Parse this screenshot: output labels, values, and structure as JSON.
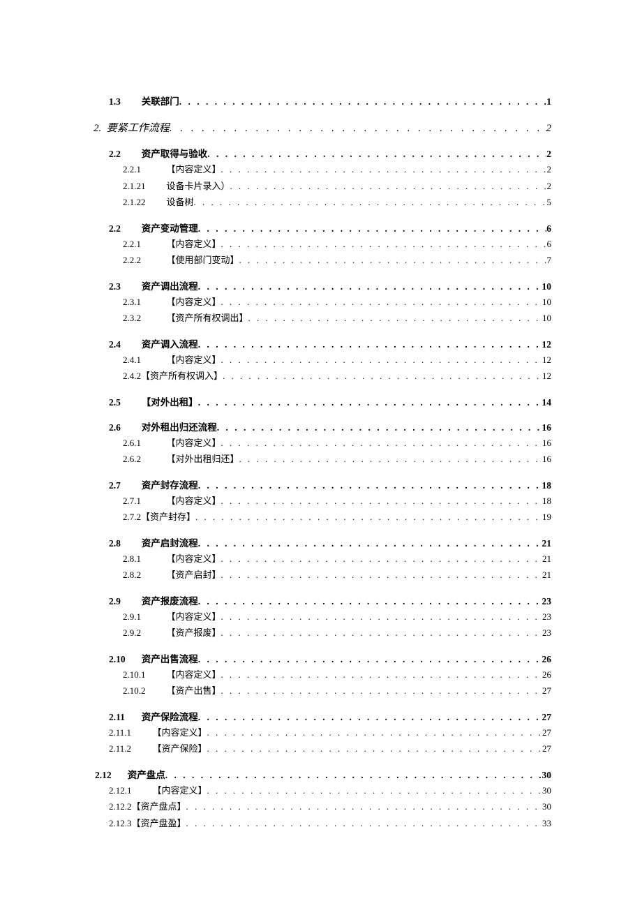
{
  "toc": [
    {
      "id": "r0",
      "level": "lvl2",
      "num": "1.3",
      "title": "关联部门",
      "page": "1"
    },
    {
      "id": "r1",
      "level": "lvl1",
      "num": "2.",
      "title": "要紧工作流程",
      "page": "2"
    },
    {
      "id": "r2",
      "level": "lvl2",
      "num": "2.2",
      "title": "资产取得与验收",
      "page": "2"
    },
    {
      "id": "r3",
      "level": "lvl3",
      "num": "2.2.1",
      "title": "【内容定义】",
      "page": "2"
    },
    {
      "id": "r4",
      "level": "lvl3",
      "num": "2.1.21",
      "title": "设备卡片录入）",
      "page": "2"
    },
    {
      "id": "r5",
      "level": "lvl3",
      "num": "2.1.22",
      "title": "设备树",
      "page": "5"
    },
    {
      "id": "r6",
      "level": "lvl2",
      "num": "2.2",
      "title": "资产变动管理",
      "page": "6"
    },
    {
      "id": "r7",
      "level": "lvl3",
      "num": "2.2.1",
      "title": "【内容定义】",
      "page": "6"
    },
    {
      "id": "r8",
      "level": "lvl3",
      "num": "2.2.2",
      "title": "【使用部门变动】",
      "page": "7"
    },
    {
      "id": "r9",
      "level": "lvl2",
      "num": "2.3",
      "title": "资产调出流程",
      "page": "10"
    },
    {
      "id": "r10",
      "level": "lvl3",
      "num": "2.3.1",
      "title": "【内容定义】",
      "page": "10"
    },
    {
      "id": "r11",
      "level": "lvl3",
      "num": "2.3.2",
      "title": "【资产所有权调出】",
      "page": "10"
    },
    {
      "id": "r12",
      "level": "lvl2",
      "num": "2.4",
      "title": "资产调入流程",
      "page": "12"
    },
    {
      "id": "r13",
      "level": "lvl3",
      "num": "2.4.1",
      "title": "【内容定义】",
      "page": "12"
    },
    {
      "id": "r14",
      "level": "lvl3 tight",
      "num": "2.4.2",
      "title": "【资产所有权调入】",
      "page": "12"
    },
    {
      "id": "r15",
      "level": "lvl2",
      "num": "2.5",
      "title": "【对外出租】",
      "page": "14"
    },
    {
      "id": "r16",
      "level": "lvl2",
      "num": "2.6",
      "title": "对外租出归还流程",
      "page": "16"
    },
    {
      "id": "r17",
      "level": "lvl3",
      "num": "2.6.1",
      "title": "【内容定义】",
      "page": "16"
    },
    {
      "id": "r18",
      "level": "lvl3",
      "num": "2.6.2",
      "title": "【对外出租归还】",
      "page": "16"
    },
    {
      "id": "r19",
      "level": "lvl2",
      "num": "2.7",
      "title": "资产封存流程",
      "page": "18"
    },
    {
      "id": "r20",
      "level": "lvl3",
      "num": "2.7.1",
      "title": "【内容定义】",
      "page": "18"
    },
    {
      "id": "r21",
      "level": "lvl3 tight",
      "num": "2.7.2",
      "title": "【资产封存】",
      "page": "19"
    },
    {
      "id": "r22",
      "level": "lvl2",
      "num": "2.8",
      "title": "资产启封流程",
      "page": "21"
    },
    {
      "id": "r23",
      "level": "lvl3",
      "num": "2.8.1",
      "title": "【内容定义】",
      "page": "21"
    },
    {
      "id": "r24",
      "level": "lvl3",
      "num": "2.8.2",
      "title": "【资产启封】",
      "page": "21"
    },
    {
      "id": "r25",
      "level": "lvl2",
      "num": "2.9",
      "title": "资产报废流程",
      "page": "23"
    },
    {
      "id": "r26",
      "level": "lvl3",
      "num": "2.9.1",
      "title": "【内容定义】",
      "page": "23"
    },
    {
      "id": "r27",
      "level": "lvl3",
      "num": "2.9.2",
      "title": "【资产报废】",
      "page": "23"
    },
    {
      "id": "r28",
      "level": "lvl2",
      "num": "2.10",
      "title": "资产出售流程",
      "page": "26"
    },
    {
      "id": "r29",
      "level": "lvl3",
      "num": "2.10.1",
      "title": "【内容定义】",
      "page": "26"
    },
    {
      "id": "r30",
      "level": "lvl3",
      "num": "2.10.2",
      "title": "【资产出售】",
      "page": "27"
    },
    {
      "id": "r31",
      "level": "lvl2",
      "num": "2.11",
      "title": "资产保险流程",
      "page": "27"
    },
    {
      "id": "r32",
      "level": "lvl3 alt",
      "num": "2.11.1",
      "title": "【内容定义】",
      "page": "27"
    },
    {
      "id": "r33",
      "level": "lvl3 alt",
      "num": "2.11.2",
      "title": "【资产保险】",
      "page": "27"
    },
    {
      "id": "r34",
      "level": "lvl2 alt",
      "num": "2.12",
      "title": "资产盘点",
      "page": "30"
    },
    {
      "id": "r35",
      "level": "lvl3 alt",
      "num": "2.12.1",
      "title": "【内容定义】",
      "page": "30"
    },
    {
      "id": "r36",
      "level": "lvl3 alt tight",
      "num": "2.12.2",
      "title": "【资产盘点】",
      "page": "30"
    },
    {
      "id": "r37",
      "level": "lvl3 alt tight",
      "num": "2.12.3",
      "title": "【资产盘盈】",
      "page": "33"
    }
  ]
}
